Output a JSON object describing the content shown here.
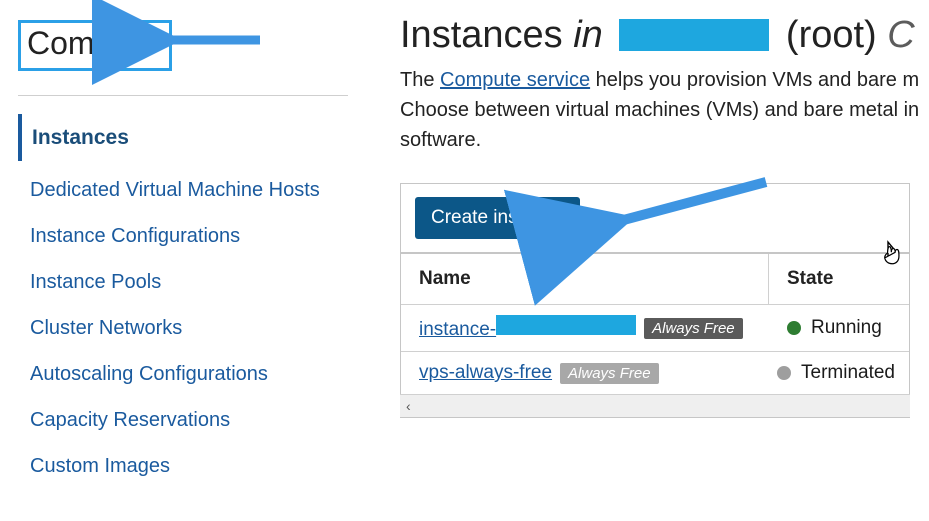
{
  "sidebar": {
    "title": "Compute",
    "items": [
      {
        "label": "Instances",
        "active": true
      },
      {
        "label": "Dedicated Virtual Machine Hosts"
      },
      {
        "label": "Instance Configurations"
      },
      {
        "label": "Instance Pools"
      },
      {
        "label": "Cluster Networks"
      },
      {
        "label": "Autoscaling Configurations"
      },
      {
        "label": "Capacity Reservations"
      },
      {
        "label": "Custom Images"
      }
    ]
  },
  "heading": {
    "prefix": "Instances ",
    "in": "in",
    "root": "(root) ",
    "trail": "C"
  },
  "description": {
    "before_link": "The ",
    "link": "Compute service",
    "after_link": " helps you provision VMs and bare m",
    "line2": "Choose between virtual machines (VMs) and bare metal in",
    "line3": "software."
  },
  "toolbar": {
    "create_label": "Create instance"
  },
  "table": {
    "headers": {
      "name": "Name",
      "state": "State"
    },
    "rows": [
      {
        "name_prefix": "instance-",
        "name_redacted": true,
        "badge": "Always Free",
        "badge_style": "dark",
        "state": "Running",
        "state_color": "green"
      },
      {
        "name_prefix": "vps-always-free",
        "name_redacted": false,
        "badge": "Always Free",
        "badge_style": "light",
        "state": "Terminated",
        "state_color": "gray"
      }
    ]
  },
  "annotations": {
    "arrow_compute": true,
    "arrow_create": true,
    "cursor": "pointer-icon"
  }
}
